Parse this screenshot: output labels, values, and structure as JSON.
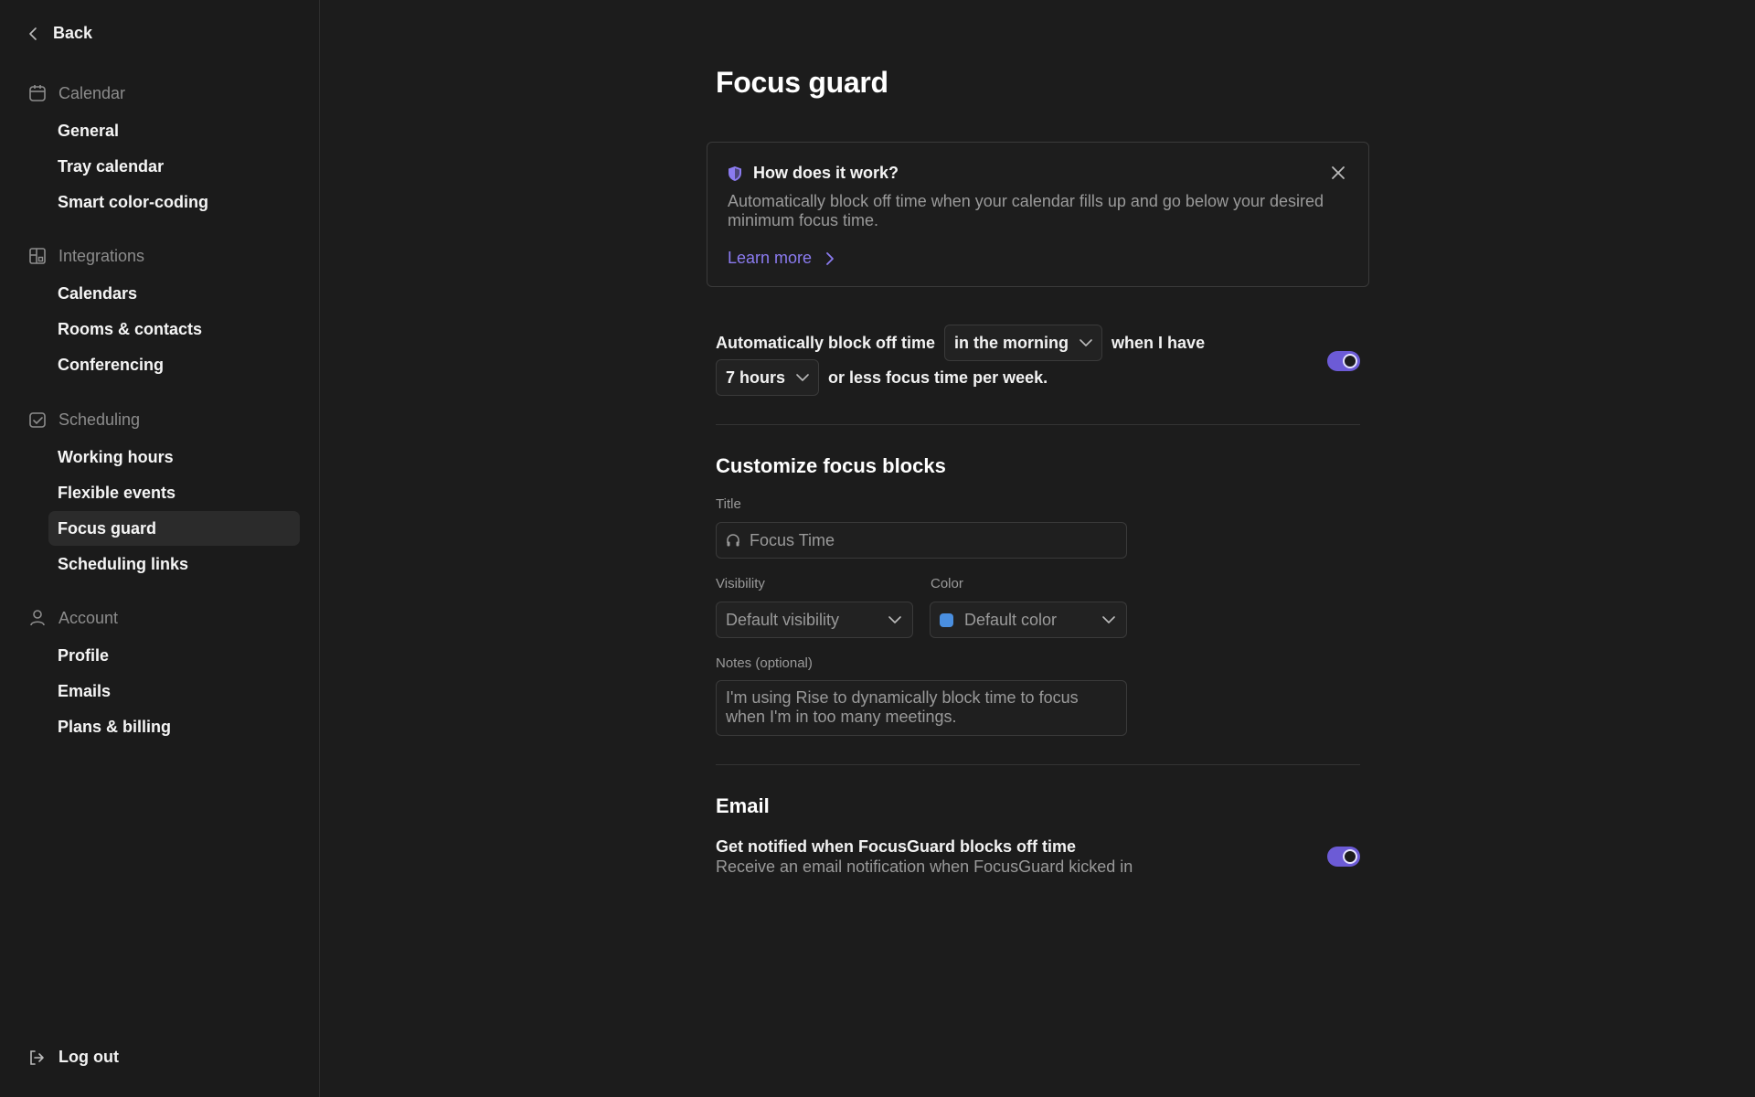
{
  "sidebar": {
    "back_label": "Back",
    "sections": [
      {
        "title": "Calendar",
        "icon": "calendar-icon",
        "items": [
          "General",
          "Tray calendar",
          "Smart color-coding"
        ]
      },
      {
        "title": "Integrations",
        "icon": "integrations-icon",
        "items": [
          "Calendars",
          "Rooms & contacts",
          "Conferencing"
        ]
      },
      {
        "title": "Scheduling",
        "icon": "scheduling-icon",
        "items": [
          "Working hours",
          "Flexible events",
          "Focus guard",
          "Scheduling links"
        ]
      },
      {
        "title": "Account",
        "icon": "user-icon",
        "items": [
          "Profile",
          "Emails",
          "Plans & billing"
        ]
      }
    ],
    "active_item": "Focus guard",
    "logout_label": "Log out"
  },
  "main": {
    "title": "Focus guard",
    "info": {
      "title": "How does it work?",
      "description": "Automatically block off time when your calendar fills up and go below your desired minimum focus time.",
      "learn_more": "Learn more"
    },
    "rule": {
      "text1": "Automatically block off time",
      "time_of_day": "in the morning",
      "text2": "when I have",
      "hours": "7 hours",
      "text3": "or less focus time per week.",
      "enabled": true
    },
    "customize": {
      "heading": "Customize focus blocks",
      "title_label": "Title",
      "title_placeholder": "Focus Time",
      "visibility_label": "Visibility",
      "visibility_value": "Default visibility",
      "color_label": "Color",
      "color_value": "Default color",
      "color_swatch": "#4a8fe0",
      "notes_label": "Notes (optional)",
      "notes_placeholder": "I'm using Rise to dynamically block time to focus when I'm in too many meetings."
    },
    "email": {
      "heading": "Email",
      "notify_title": "Get notified when FocusGuard blocks off time",
      "notify_desc": "Receive an email notification when FocusGuard kicked in",
      "enabled": true
    }
  },
  "colors": {
    "background": "#1c1c1c",
    "accent": "#6c5bd6",
    "link": "#8b7bf0",
    "muted_text": "#9a9a9a"
  }
}
